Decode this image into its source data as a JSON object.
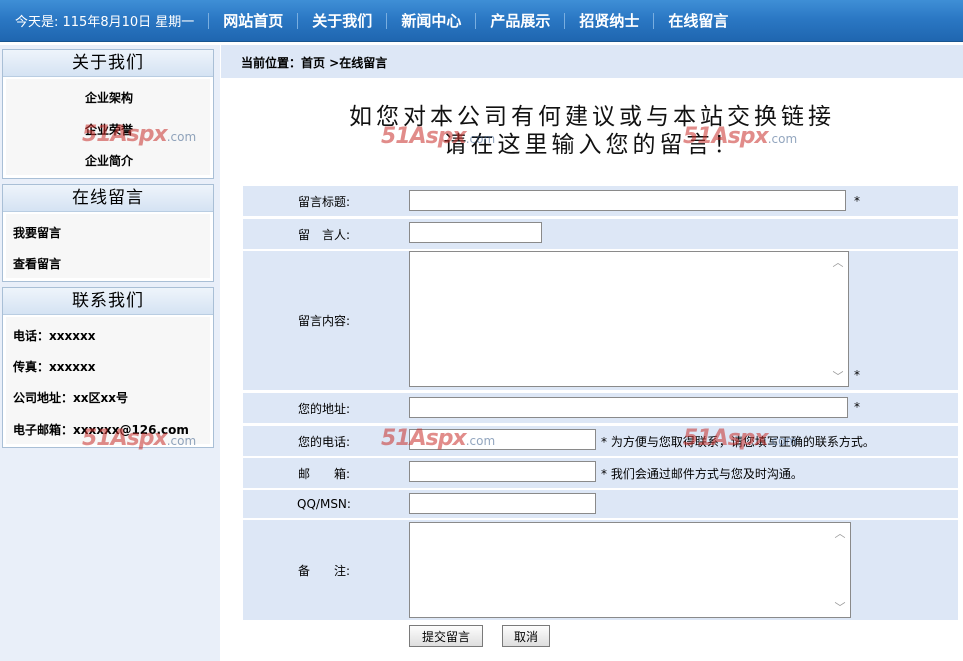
{
  "topbar": {
    "date": "今天是: 115年8月10日 星期一",
    "nav": [
      "网站首页",
      "关于我们",
      "新闻中心",
      "产品展示",
      "招贤纳士",
      "在线留言"
    ]
  },
  "sidebar": {
    "about": {
      "title": "关于我们",
      "items": [
        "企业架构",
        "企业荣誉",
        "企业简介"
      ]
    },
    "message": {
      "title": "在线留言",
      "items": [
        "我要留言",
        "查看留言"
      ]
    },
    "contact": {
      "title": "联系我们",
      "items": [
        "电话：xxxxxx",
        "传真：xxxxxx",
        "公司地址：xx区xx号",
        "电子邮箱：xxxxxx@126.com"
      ]
    }
  },
  "breadcrumb": "当前位置：首页 >在线留言",
  "headline": {
    "line1": "如您对本公司有何建议或与本站交换链接",
    "line2": "请在这里输入您的留言！"
  },
  "form": {
    "title_label": "留言标题:",
    "author_label": "留　言人:",
    "content_label": "留言内容:",
    "address_label": "您的地址:",
    "phone_label": "您的电话:",
    "email_label": "邮　　箱:",
    "qq_label": "QQ/MSN:",
    "remark_label": "备　　注:",
    "required_mark": "*",
    "phone_hint": "* 为方便与您取得联系，请您填写正确的联系方式。",
    "email_hint": "* 我们会通过邮件方式与您及时沟通。",
    "submit_label": "提交留言",
    "cancel_label": "取消"
  },
  "watermark": {
    "brand": "51Aspx",
    "suffix": ".com"
  },
  "colors": {
    "nav": "#2b78c4",
    "row_bg": "#dde7f6",
    "sidebar_bg": "#e9eff9"
  }
}
